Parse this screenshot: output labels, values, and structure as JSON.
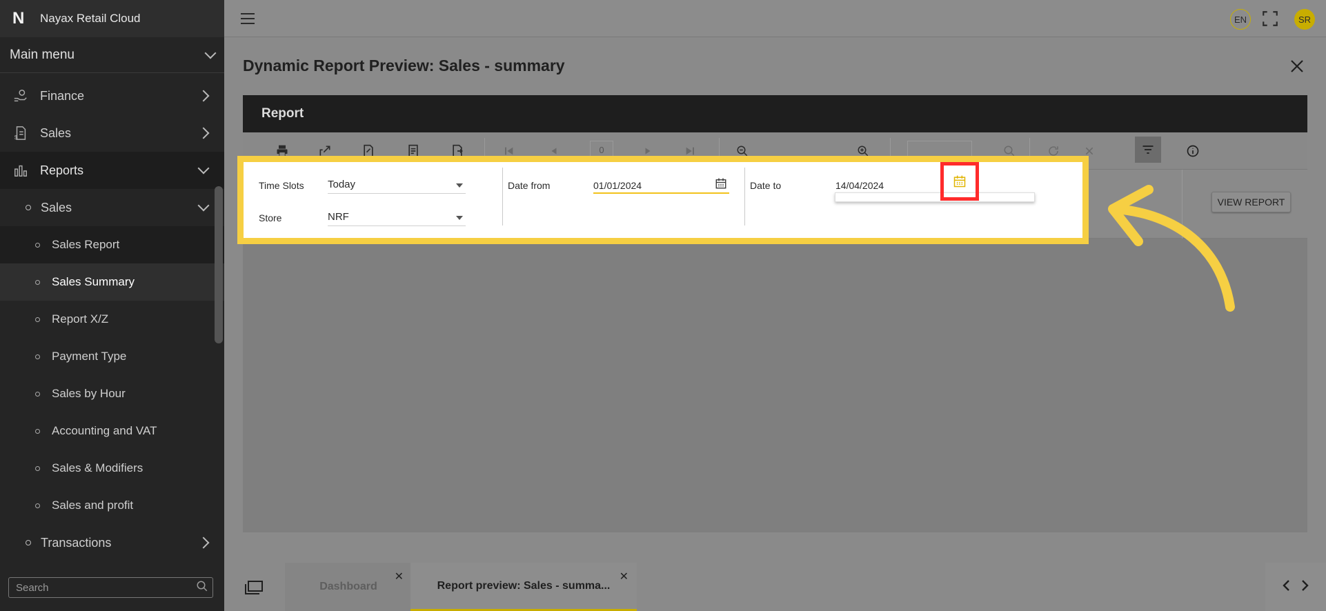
{
  "brand": {
    "title": "Nayax Retail Cloud",
    "logo": "N"
  },
  "sidebar": {
    "main_menu": "Main menu",
    "items": [
      {
        "label": "Finance"
      },
      {
        "label": "Sales"
      },
      {
        "label": "Reports"
      }
    ],
    "reports_group": "Sales",
    "leaves": [
      {
        "label": "Sales Report"
      },
      {
        "label": "Sales Summary"
      },
      {
        "label": "Report X/Z"
      },
      {
        "label": "Payment Type"
      },
      {
        "label": "Sales by Hour"
      },
      {
        "label": "Accounting and VAT"
      },
      {
        "label": "Sales & Modifiers"
      },
      {
        "label": "Sales and profit"
      }
    ],
    "transactions": "Transactions",
    "search_placeholder": "Search"
  },
  "topbar": {
    "lang": "EN",
    "avatar": "SR"
  },
  "page": {
    "title": "Dynamic Report Preview: Sales - summary"
  },
  "report": {
    "header": "Report",
    "page_number": "0",
    "view_report": "VIEW REPORT"
  },
  "params": {
    "time_slots_label": "Time Slots",
    "time_slots_value": "Today",
    "store_label": "Store",
    "store_value": "NRF",
    "date_from_label": "Date from",
    "date_from_value": "01/01/2024",
    "date_to_label": "Date to",
    "date_to_value": "14/04/2024"
  },
  "tabs": [
    {
      "label": "Dashboard",
      "close": "✕"
    },
    {
      "label": "Report preview: Sales - summa...",
      "close": "✕"
    }
  ],
  "colors": {
    "highlight": "#f6cf43",
    "focus_box": "#ff2b2b",
    "accent": "#c8ad00"
  }
}
